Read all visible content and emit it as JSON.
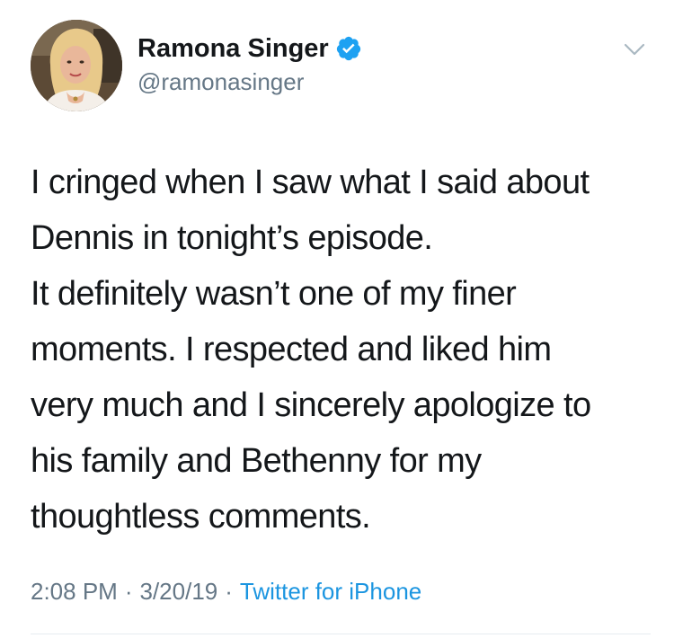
{
  "user": {
    "display_name": "Ramona Singer",
    "handle": "@ramonasinger",
    "verified": true,
    "avatar_icon": "profile-photo"
  },
  "tweet": {
    "text": "I cringed when I saw what I said about\nDennis in tonight’s episode.\nIt definitely wasn’t one of my finer\nmoments. I respected and liked him\nvery much and I sincerely apologize to\nhis family and Bethenny for my\nthoughtless comments."
  },
  "meta": {
    "time": "2:08 PM",
    "date": "3/20/19",
    "separator": "·",
    "source": "Twitter for iPhone"
  },
  "colors": {
    "text": "#14171a",
    "secondary": "#657786",
    "link": "#1b95e0",
    "verified": "#1da1f2",
    "divider": "#e6ecf0"
  },
  "icons": {
    "verified": "verified-badge-icon",
    "caret": "chevron-down-icon"
  }
}
